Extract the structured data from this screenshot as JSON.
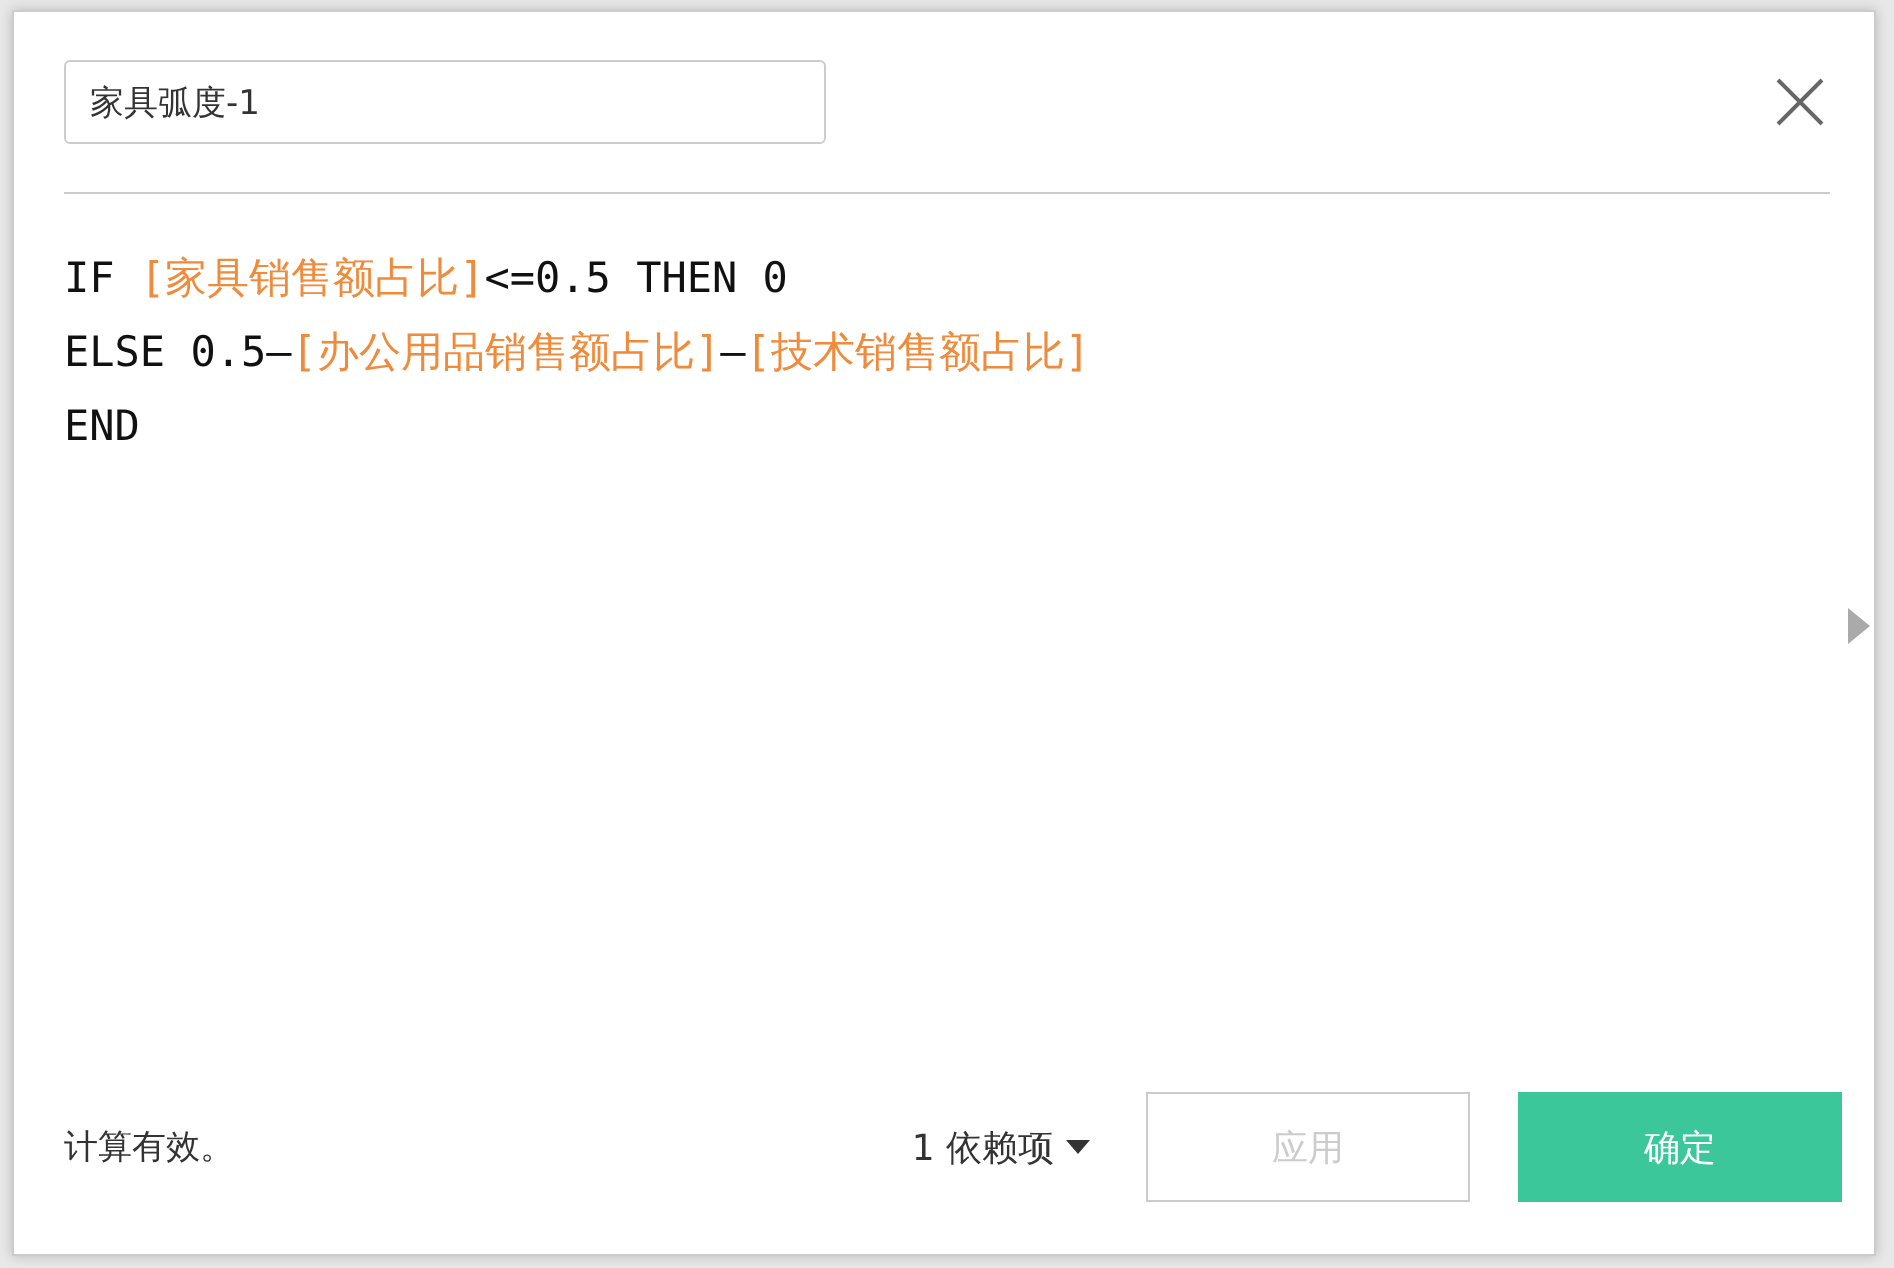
{
  "name_field": {
    "value": "家具弧度-1"
  },
  "formula": [
    {
      "segments": [
        {
          "kind": "code",
          "text": "IF "
        },
        {
          "kind": "field",
          "text": "[家具销售额占比]"
        },
        {
          "kind": "code",
          "text": "<=0.5 THEN 0"
        }
      ]
    },
    {
      "segments": [
        {
          "kind": "code",
          "text": "ELSE 0.5–"
        },
        {
          "kind": "field",
          "text": "[办公用品销售额占比]"
        },
        {
          "kind": "code",
          "text": "–"
        },
        {
          "kind": "field",
          "text": "[技术销售额占比]"
        }
      ]
    },
    {
      "segments": [
        {
          "kind": "code",
          "text": "END"
        }
      ]
    }
  ],
  "status": "计算有效。",
  "dependencies": "1 依赖项",
  "buttons": [
    {
      "label": "应用",
      "kind": "secondary",
      "disabled": true
    },
    {
      "label": "确定",
      "kind": "primary",
      "disabled": false
    }
  ]
}
